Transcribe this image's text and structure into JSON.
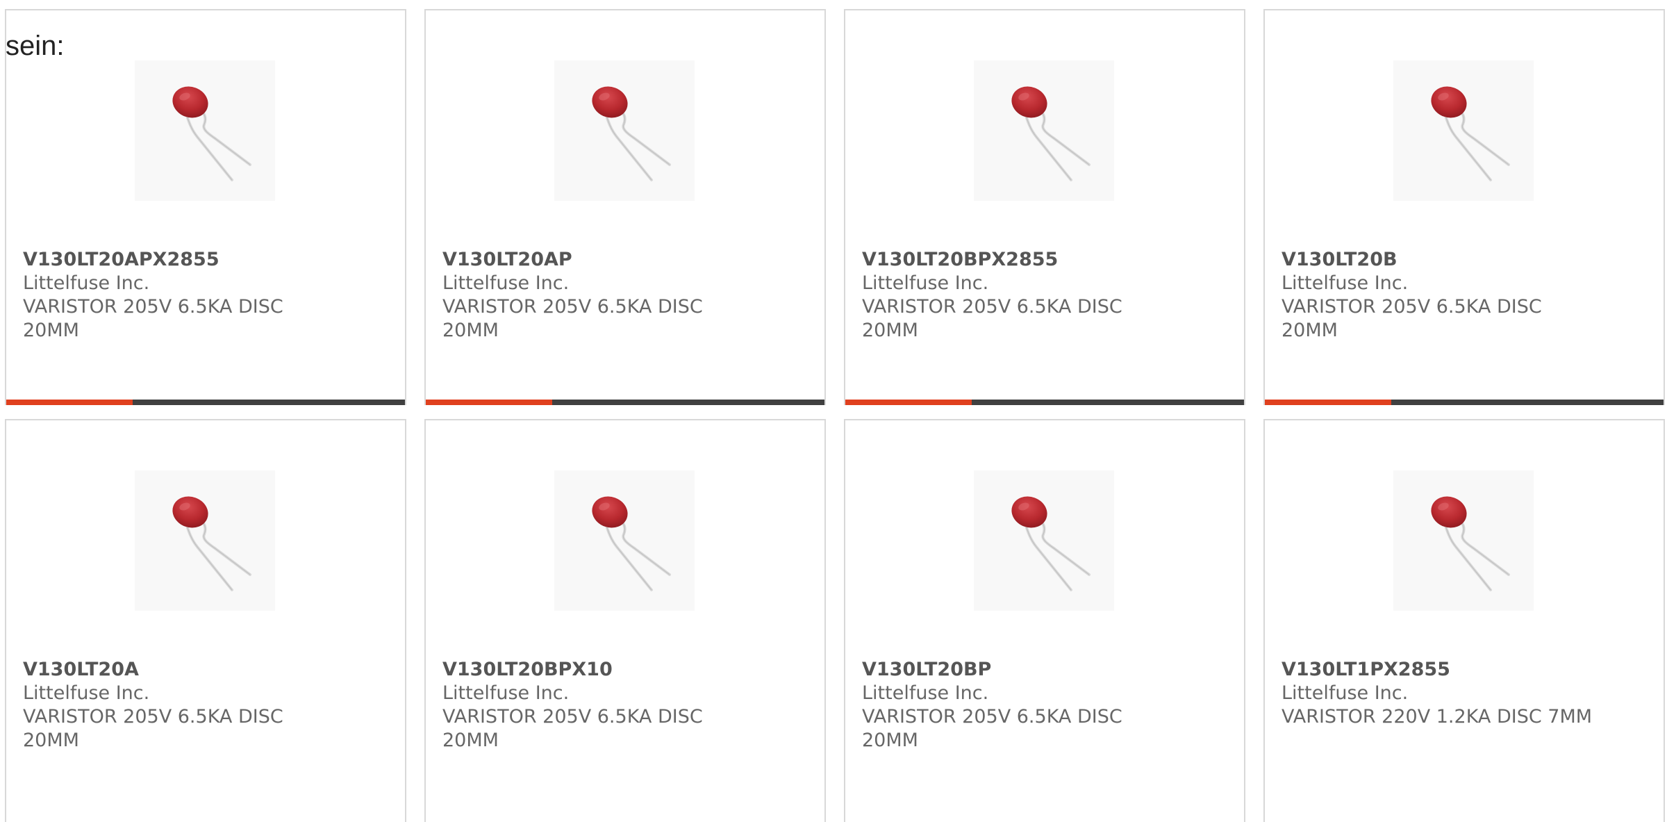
{
  "intro_text": "sein:",
  "colors": {
    "accent": "#e0401e",
    "bar": "#404040",
    "border": "#d8d8d8"
  },
  "products": [
    {
      "part": "V130LT20APX2855",
      "manufacturer": "Littelfuse Inc.",
      "description": "VARISTOR 205V 6.5KA DISC 20MM",
      "image_icon": "varistor-disc-icon"
    },
    {
      "part": "V130LT20AP",
      "manufacturer": "Littelfuse Inc.",
      "description": "VARISTOR 205V 6.5KA DISC 20MM",
      "image_icon": "varistor-disc-icon"
    },
    {
      "part": "V130LT20BPX2855",
      "manufacturer": "Littelfuse Inc.",
      "description": "VARISTOR 205V 6.5KA DISC 20MM",
      "image_icon": "varistor-disc-icon"
    },
    {
      "part": "V130LT20B",
      "manufacturer": "Littelfuse Inc.",
      "description": "VARISTOR 205V 6.5KA DISC 20MM",
      "image_icon": "varistor-disc-icon"
    },
    {
      "part": "V130LT20A",
      "manufacturer": "Littelfuse Inc.",
      "description": "VARISTOR 205V 6.5KA DISC 20MM",
      "image_icon": "varistor-disc-icon"
    },
    {
      "part": "V130LT20BPX10",
      "manufacturer": "Littelfuse Inc.",
      "description": "VARISTOR 205V 6.5KA DISC 20MM",
      "image_icon": "varistor-disc-icon"
    },
    {
      "part": "V130LT20BP",
      "manufacturer": "Littelfuse Inc.",
      "description": "VARISTOR 205V 6.5KA DISC 20MM",
      "image_icon": "varistor-disc-icon"
    },
    {
      "part": "V130LT1PX2855",
      "manufacturer": "Littelfuse Inc.",
      "description": "VARISTOR 220V 1.2KA DISC 7MM",
      "image_icon": "varistor-disc-icon"
    }
  ]
}
